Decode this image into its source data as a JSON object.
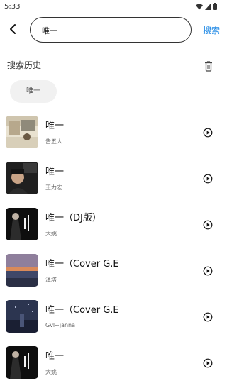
{
  "status_bar": {
    "time": "5:33"
  },
  "header": {
    "search_value": "唯一",
    "search_button": "搜索"
  },
  "history": {
    "title": "搜索历史",
    "items": [
      "唯一"
    ]
  },
  "songs": [
    {
      "title": "唯一",
      "artist": "告五人"
    },
    {
      "title": "唯一",
      "artist": "王力宏"
    },
    {
      "title": "唯一（DJ版）",
      "artist": "大姚"
    },
    {
      "title": "唯一（Cover G.E",
      "artist": "泽塔"
    },
    {
      "title": "唯一（Cover G.E",
      "artist": "Gvl~jannaT"
    },
    {
      "title": "唯一",
      "artist": "大姚"
    }
  ],
  "colors": {
    "accent": "#1e88e5"
  }
}
